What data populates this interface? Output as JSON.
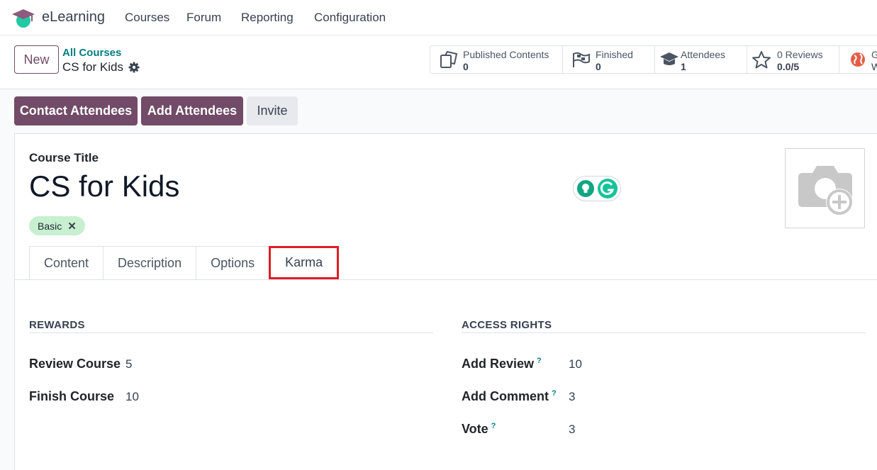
{
  "navbar": {
    "brand": "eLearning",
    "menu": [
      "Courses",
      "Forum",
      "Reporting",
      "Configuration"
    ]
  },
  "control_panel": {
    "new_label": "New",
    "breadcrumb_parent": "All Courses",
    "breadcrumb_current": "CS for Kids",
    "stats": [
      {
        "label": "Published Contents",
        "value": "0",
        "icon": "documents-icon"
      },
      {
        "label": "Finished",
        "value": "0",
        "icon": "flag-icon"
      },
      {
        "label": "Attendees",
        "value": "1",
        "icon": "graduation-cap-icon"
      },
      {
        "label": "0 Reviews",
        "value": "0.0/5",
        "icon": "star-icon"
      },
      {
        "label": "G",
        "value": "W",
        "icon": "globe-icon"
      }
    ]
  },
  "actions": {
    "contact_attendees": "Contact Attendees",
    "add_attendees": "Add Attendees",
    "invite": "Invite"
  },
  "form": {
    "title_label": "Course Title",
    "title_value": "CS for Kids",
    "tag": "Basic",
    "tabs": [
      "Content",
      "Description",
      "Options",
      "Karma"
    ],
    "active_tab": "Karma",
    "rewards": {
      "heading": "REWARDS",
      "fields": [
        {
          "label": "Review Course",
          "value": "5"
        },
        {
          "label": "Finish Course",
          "value": "10"
        }
      ]
    },
    "access_rights": {
      "heading": "ACCESS RIGHTS",
      "fields": [
        {
          "label": "Add Review",
          "help": "?",
          "value": "10"
        },
        {
          "label": "Add Comment",
          "help": "?",
          "value": "3"
        },
        {
          "label": "Vote",
          "help": "?",
          "value": "3"
        }
      ]
    }
  },
  "colors": {
    "brand": "#714b67",
    "link": "#017e84",
    "tag_bg": "#c8efcf",
    "highlight": "#e11d24"
  }
}
